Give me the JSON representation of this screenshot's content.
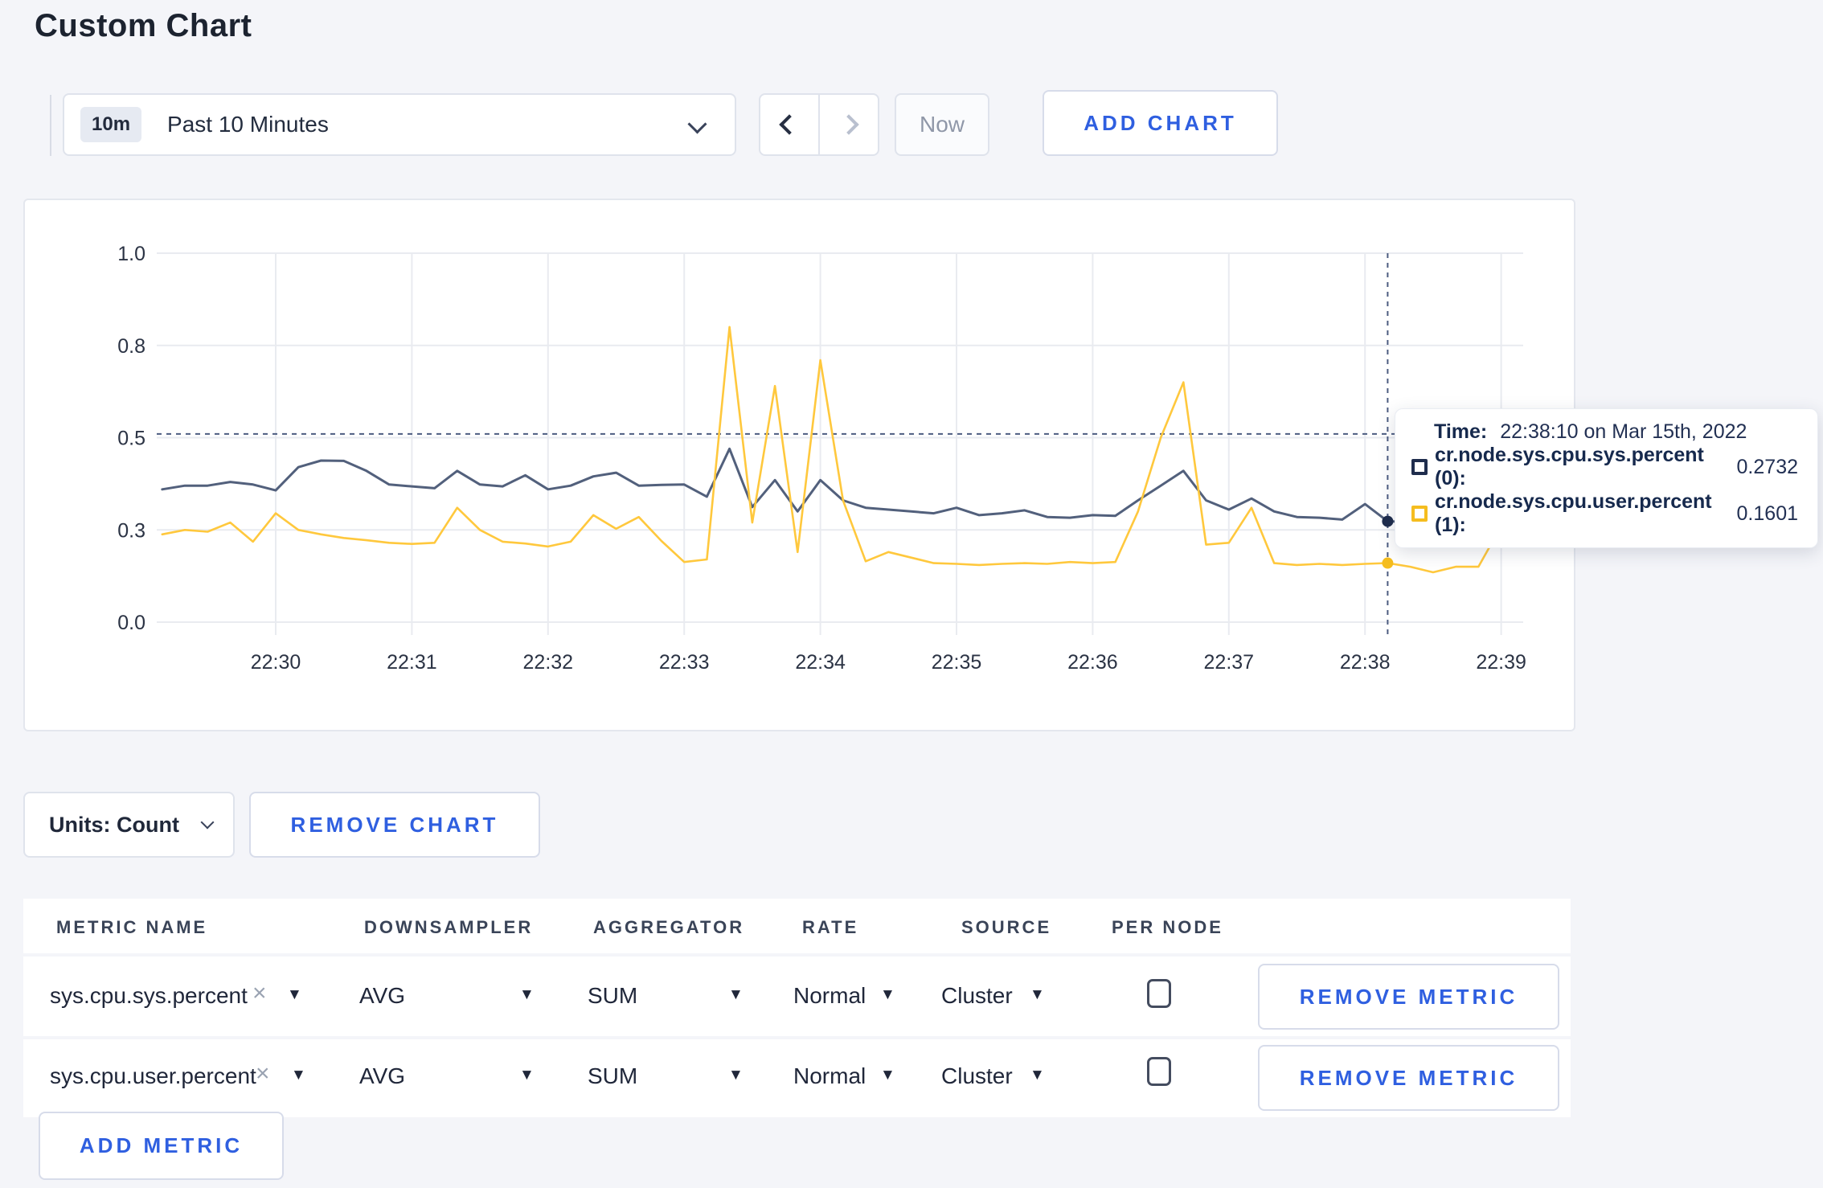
{
  "page": {
    "title": "Custom Chart",
    "background": "#f4f5f9",
    "accent_blue": "#2f5fe0"
  },
  "toolbar": {
    "time_range": {
      "badge": "10m",
      "label": "Past 10 Minutes"
    },
    "now_label": "Now",
    "add_chart_label": "ADD CHART"
  },
  "icons": {
    "caret_down": "▼",
    "close": "×"
  },
  "chart_data": {
    "type": "line",
    "title": "",
    "xlabel": "",
    "ylabel": "",
    "ylim": [
      0,
      1
    ],
    "grid": true,
    "x_labels": [
      "22:30",
      "22:31",
      "22:32",
      "22:33",
      "22:34",
      "22:35",
      "22:36",
      "22:37",
      "22:38",
      "22:39"
    ],
    "y_tick_labels": [
      "0.0",
      "0.3",
      "0.5",
      "0.8",
      "1.0"
    ],
    "y_tick_values": [
      0,
      0.25,
      0.5,
      0.75,
      1.0
    ],
    "x_start": "22:29:10",
    "x_step_seconds": 10,
    "series": [
      {
        "name": "cr.node.sys.cpu.sys.percent",
        "color": "#52607c",
        "values": [
          0.36,
          0.37,
          0.37,
          0.38,
          0.373,
          0.357,
          0.42,
          0.438,
          0.437,
          0.41,
          0.373,
          0.368,
          0.363,
          0.41,
          0.373,
          0.368,
          0.398,
          0.36,
          0.37,
          0.395,
          0.405,
          0.37,
          0.372,
          0.373,
          0.34,
          0.47,
          0.312,
          0.385,
          0.3,
          0.385,
          0.33,
          0.31,
          0.305,
          0.3,
          0.295,
          0.31,
          0.29,
          0.295,
          0.303,
          0.285,
          0.283,
          0.29,
          0.288,
          0.33,
          0.37,
          0.41,
          0.33,
          0.305,
          0.335,
          0.3,
          0.285,
          0.283,
          0.278,
          0.32,
          0.2732,
          0.272,
          0.283,
          0.295,
          0.278,
          0.3,
          0.296
        ]
      },
      {
        "name": "cr.node.sys.cpu.user.percent",
        "color": "#ffc83d",
        "values": [
          0.238,
          0.25,
          0.245,
          0.27,
          0.218,
          0.295,
          0.25,
          0.238,
          0.228,
          0.222,
          0.215,
          0.212,
          0.215,
          0.31,
          0.25,
          0.218,
          0.213,
          0.205,
          0.218,
          0.29,
          0.253,
          0.285,
          0.22,
          0.163,
          0.17,
          0.8,
          0.27,
          0.64,
          0.19,
          0.71,
          0.33,
          0.165,
          0.19,
          0.175,
          0.16,
          0.158,
          0.155,
          0.158,
          0.16,
          0.158,
          0.163,
          0.16,
          0.163,
          0.3,
          0.5,
          0.65,
          0.21,
          0.215,
          0.31,
          0.16,
          0.155,
          0.158,
          0.155,
          0.158,
          0.1601,
          0.15,
          0.135,
          0.15,
          0.15,
          0.26,
          0.235
        ]
      }
    ],
    "hover": {
      "index": 54,
      "time": "22:38:10",
      "dashed_y_value": 0.51
    },
    "legend_position": "tooltip"
  },
  "tooltip": {
    "time_label": "Time:",
    "time_value": "22:38:10 on Mar 15th, 2022",
    "series": [
      {
        "label": "cr.node.sys.cpu.sys.percent (0):",
        "value": "0.2732",
        "color": "#1f2d4d"
      },
      {
        "label": "cr.node.sys.cpu.user.percent (1):",
        "value": "0.1601",
        "color": "#f5bd1f"
      }
    ]
  },
  "chart_footer": {
    "units_label": "Units: Count",
    "remove_chart_label": "REMOVE CHART"
  },
  "metrics_table": {
    "headers": [
      "METRIC NAME",
      "DOWNSAMPLER",
      "AGGREGATOR",
      "RATE",
      "SOURCE",
      "PER NODE"
    ],
    "rows": [
      {
        "metric": "sys.cpu.sys.percent",
        "downsampler": "AVG",
        "aggregator": "SUM",
        "rate": "Normal",
        "source": "Cluster",
        "per_node_checked": false,
        "remove_label": "REMOVE METRIC"
      },
      {
        "metric": "sys.cpu.user.percent",
        "downsampler": "AVG",
        "aggregator": "SUM",
        "rate": "Normal",
        "source": "Cluster",
        "per_node_checked": false,
        "remove_label": "REMOVE METRIC"
      }
    ],
    "add_metric_label": "ADD METRIC"
  }
}
